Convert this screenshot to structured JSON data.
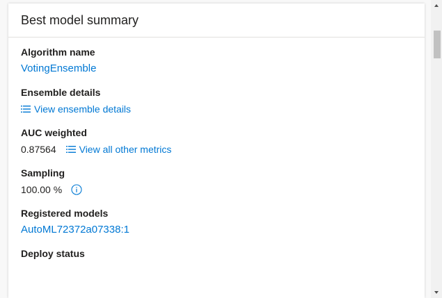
{
  "card": {
    "title": "Best model summary"
  },
  "fields": {
    "algorithm": {
      "label": "Algorithm name",
      "value": "VotingEnsemble"
    },
    "ensemble": {
      "label": "Ensemble details",
      "link": "View ensemble details"
    },
    "auc": {
      "label": "AUC weighted",
      "value": "0.87564",
      "link": "View all other metrics"
    },
    "sampling": {
      "label": "Sampling",
      "value": "100.00 %"
    },
    "registered": {
      "label": "Registered models",
      "value": "AutoML72372a07338:1"
    },
    "deploy": {
      "label": "Deploy status"
    }
  },
  "icons": {
    "list": "list-icon",
    "info": "info-icon",
    "scroll_up": "chevron-up-icon",
    "scroll_down": "chevron-down-icon"
  },
  "colors": {
    "link": "#0078d4",
    "text": "#201f1e",
    "divider": "#e1dfdd"
  }
}
